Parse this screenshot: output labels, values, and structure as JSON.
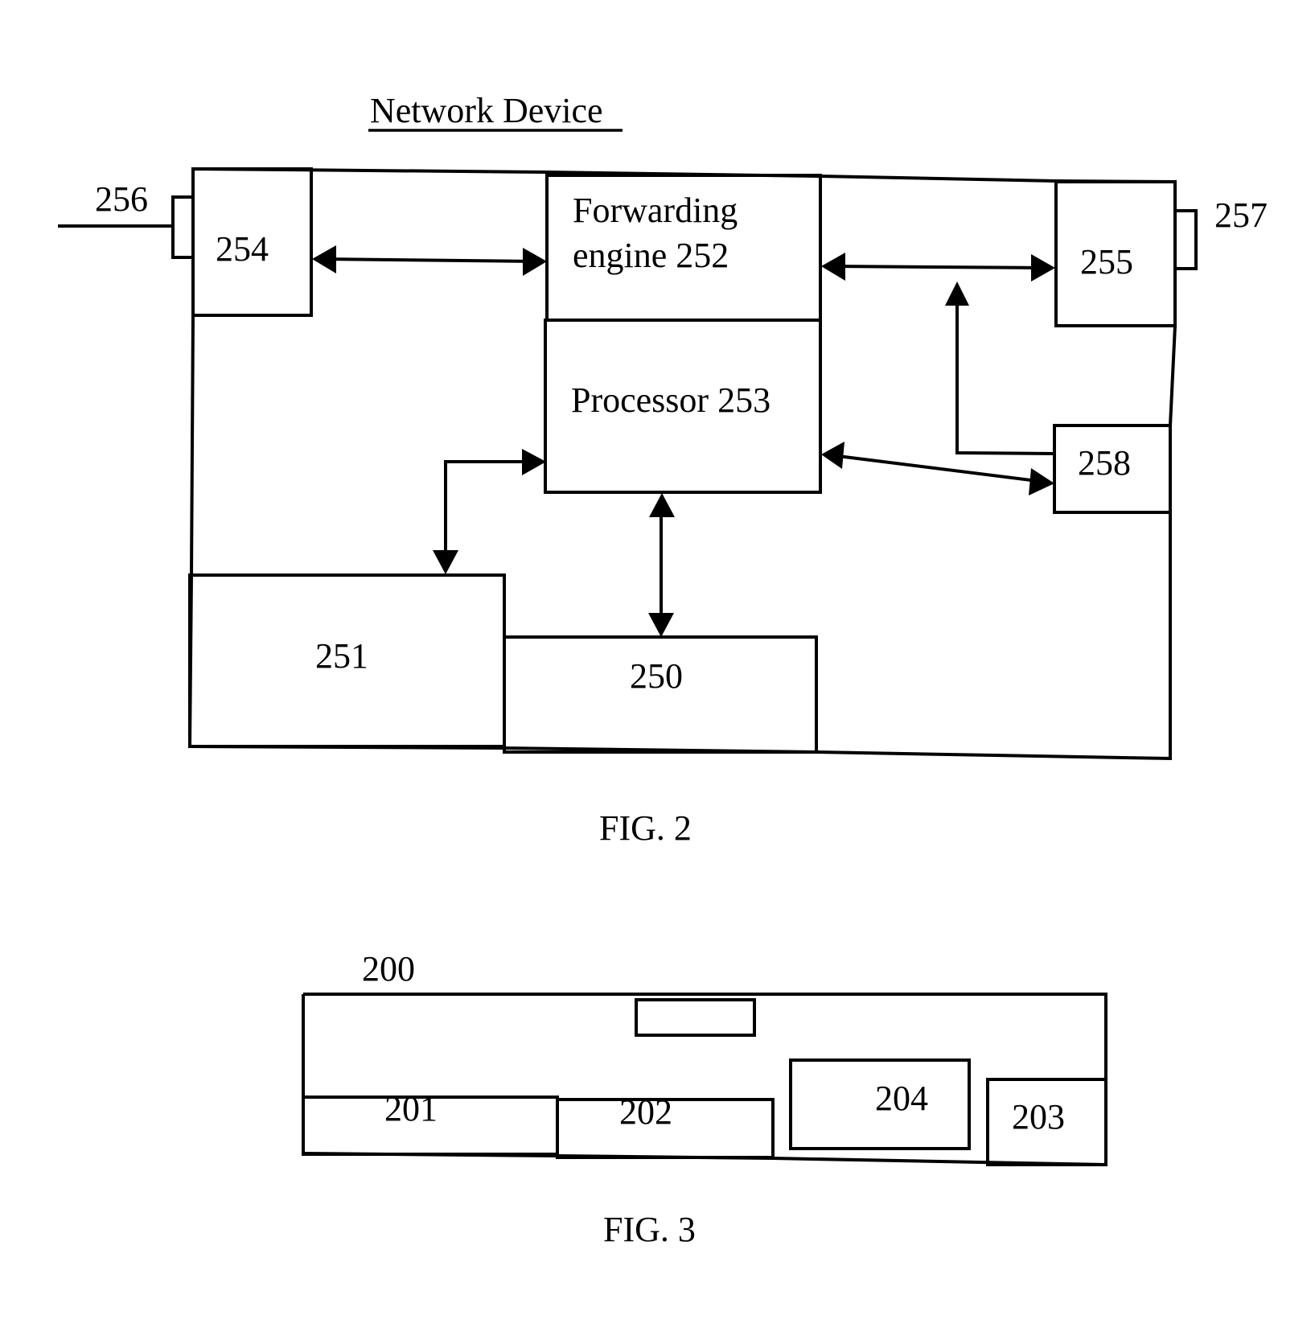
{
  "fig2": {
    "title": "Network Device",
    "caption": "FIG. 2",
    "blocks": {
      "b250": "250",
      "b251": "251",
      "b252_line1": "Forwarding",
      "b252_line2": "engine 252",
      "b253": "Processor 253",
      "b254": "254",
      "b255": "255",
      "b258": "258"
    },
    "ports": {
      "p256": "256",
      "p257": "257"
    },
    "connections": [
      {
        "from": "254",
        "to": "252",
        "type": "bidirectional"
      },
      {
        "from": "252",
        "to": "255",
        "type": "bidirectional"
      },
      {
        "from": "258",
        "to": "252-255 link",
        "type": "unidirectional"
      },
      {
        "from": "253",
        "to": "258",
        "type": "bidirectional"
      },
      {
        "from": "253",
        "to": "251",
        "type": "bidirectional"
      },
      {
        "from": "253",
        "to": "250",
        "type": "bidirectional"
      }
    ]
  },
  "fig3": {
    "caption": "FIG. 3",
    "container": "200",
    "blocks": {
      "b201": "201",
      "b202": "202",
      "b203": "203",
      "b204": "204"
    }
  }
}
